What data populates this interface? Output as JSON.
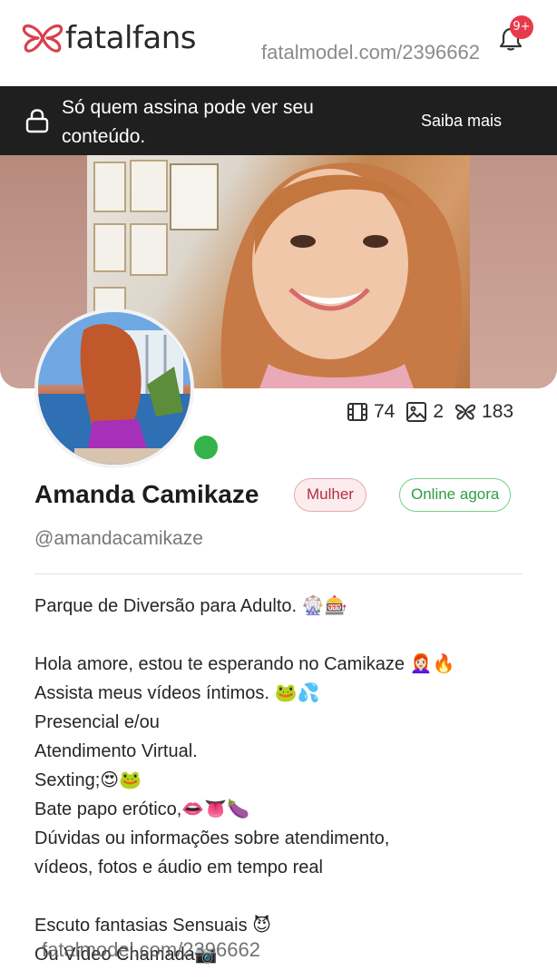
{
  "header": {
    "brand": "fatalfans",
    "watermark": "fatalmodel.com/2396662",
    "notification_badge": "9+"
  },
  "banner": {
    "message": "Só quem assina pode ver seu conteúdo.",
    "link": "Saiba mais"
  },
  "stats": {
    "videos": "74",
    "photos": "2",
    "likes": "183"
  },
  "profile": {
    "name": "Amanda Camikaze",
    "gender_tag": "Mulher",
    "status_tag": "Online agora",
    "handle": "@amandacamikaze"
  },
  "bio": {
    "lines": [
      "Parque de Diversão para Adulto. 🎡🎰",
      "",
      "Hola amore, estou te esperando no Camikaze 👩🏻‍🦰🔥",
      "Assista meus vídeos íntimos. 🐸💦",
      "Presencial e/ou",
      "Atendimento Virtual.",
      "Sexting;😍🐸",
      "Bate papo erótico,👄👅🍆",
      "Dúvidas ou informações sobre atendimento,",
      "vídeos, fotos e áudio em tempo real",
      "",
      "Escuto fantasias Sensuais 😈",
      "Ou Vídeo Chamada📷"
    ]
  },
  "watermark_bottom": "fatalmodel.com/2396662",
  "colors": {
    "banner_bg": "#1f1f1f",
    "brand_red": "#e8394b",
    "online_green": "#34b34a"
  }
}
